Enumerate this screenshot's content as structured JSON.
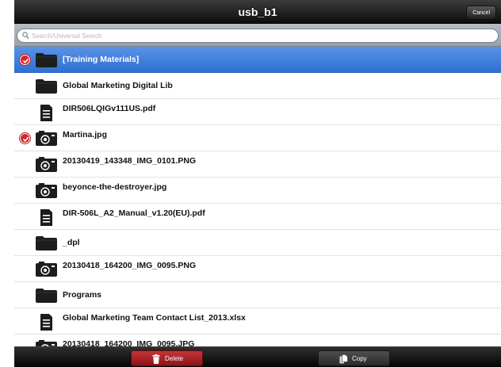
{
  "window": {
    "title": "usb_b1",
    "cancel_label": "Cancel"
  },
  "search": {
    "placeholder": "Search/Universal Search",
    "value": ""
  },
  "files": [
    {
      "name": "[Training Materials]",
      "meta": "",
      "type": "folder",
      "selected": true,
      "checked": true
    },
    {
      "name": "Global Marketing Digital Lib",
      "meta": "",
      "type": "folder",
      "selected": false,
      "checked": false
    },
    {
      "name": "DIR506LQIGv111US.pdf",
      "meta": "",
      "type": "document",
      "selected": false,
      "checked": false
    },
    {
      "name": "Martina.jpg",
      "meta": "",
      "type": "image",
      "selected": false,
      "checked": true
    },
    {
      "name": "20130419_143348_IMG_0101.PNG",
      "meta": "",
      "type": "image",
      "selected": false,
      "checked": false
    },
    {
      "name": "beyonce-the-destroyer.jpg",
      "meta": "",
      "type": "image",
      "selected": false,
      "checked": false
    },
    {
      "name": "DIR-506L_A2_Manual_v1.20(EU).pdf",
      "meta": "",
      "type": "document",
      "selected": false,
      "checked": false
    },
    {
      "name": "_dpl",
      "meta": "",
      "type": "folder",
      "selected": false,
      "checked": false
    },
    {
      "name": "20130418_164200_IMG_0095.PNG",
      "meta": "",
      "type": "image",
      "selected": false,
      "checked": false
    },
    {
      "name": "Programs",
      "meta": "",
      "type": "folder",
      "selected": false,
      "checked": false
    },
    {
      "name": "Global Marketing Team Contact List_2013.xlsx",
      "meta": "",
      "type": "document",
      "selected": false,
      "checked": false
    },
    {
      "name": "20130418_164200_IMG_0095.JPG",
      "meta": "",
      "type": "image",
      "selected": false,
      "checked": false
    }
  ],
  "toolbar": {
    "delete_label": "Delete",
    "copy_label": "Copy"
  },
  "colors": {
    "selection": "#3a7bd9",
    "delete": "#b12a2e",
    "check": "#d8242a"
  },
  "icons": {
    "search": "magnifier-icon",
    "folder": "folder-icon",
    "document": "document-icon",
    "image": "camera-icon",
    "delete": "trash-icon",
    "copy": "copy-icon"
  }
}
